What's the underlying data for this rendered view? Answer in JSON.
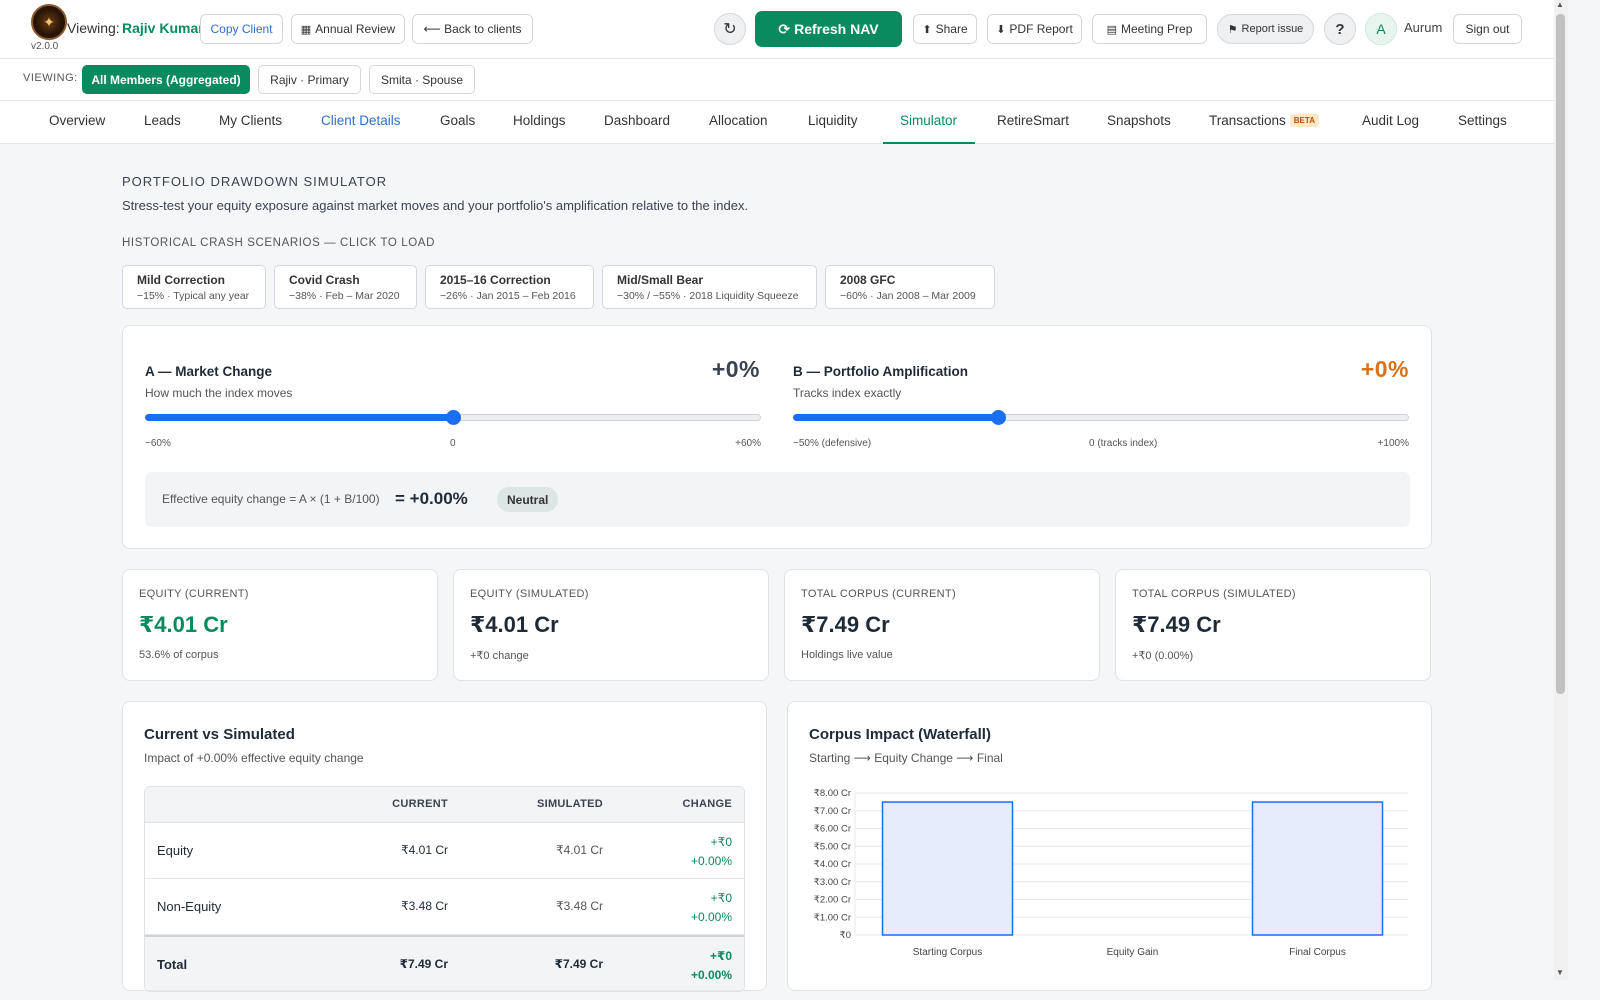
{
  "app": {
    "version": "v2.0.0",
    "viewing_label": "Viewing:",
    "client_name": "Rajiv Kumar",
    "user_initial": "A",
    "user_name": "Aurum"
  },
  "toolbar": {
    "copy_client": "Copy Client",
    "annual_review": "Annual Review",
    "back": "⟵ Back to clients",
    "refresh_nav": "Refresh NAV",
    "share": "Share",
    "pdf": "PDF Report",
    "meeting": "Meeting Prep",
    "report_issue": "Report issue",
    "help": "?",
    "sign_out": "Sign out"
  },
  "members": {
    "label": "VIEWING:",
    "items": [
      "All Members (Aggregated)",
      "Rajiv · Primary",
      "Smita · Spouse"
    ]
  },
  "tabs": [
    "Overview",
    "Leads",
    "My Clients",
    "Client Details",
    "Goals",
    "Holdings",
    "Dashboard",
    "Allocation",
    "Liquidity",
    "Simulator",
    "RetireSmart",
    "Snapshots",
    "Transactions",
    "Audit Log",
    "Settings"
  ],
  "tab_badge": "BETA",
  "simulator": {
    "title": "PORTFOLIO DRAWDOWN SIMULATOR",
    "description": "Stress-test your equity exposure against market moves and your portfolio's amplification relative to the index.",
    "scenarios_title": "HISTORICAL CRASH SCENARIOS — CLICK TO LOAD",
    "scenarios": [
      {
        "name": "Mild Correction",
        "detail": "−15% · Typical any year"
      },
      {
        "name": "Covid Crash",
        "detail": "−38% · Feb – Mar 2020"
      },
      {
        "name": "2015–16 Correction",
        "detail": "−26% · Jan 2015 – Feb 2016"
      },
      {
        "name": "Mid/Small Bear",
        "detail": "−30% / −55% · 2018 Liquidity Squeeze"
      },
      {
        "name": "2008 GFC",
        "detail": "−60% · Jan 2008 – Mar 2009"
      }
    ],
    "market": {
      "title": "A — Market Change",
      "subtitle": "How much the index moves",
      "value_label": "+0%",
      "value": 0,
      "min": -60,
      "max": 60,
      "ticks": [
        "−60%",
        "0",
        "+60%"
      ]
    },
    "amplification": {
      "title": "B — Portfolio Amplification",
      "subtitle": "Tracks index exactly",
      "value_label": "+0%",
      "value": 0,
      "min": -50,
      "max": 100,
      "ticks": [
        "−50% (defensive)",
        "0 (tracks index)",
        "+100%"
      ]
    },
    "effective": {
      "label": "Effective equity change = A × (1 + B/100)",
      "value": "= +0.00%",
      "badge": "Neutral"
    }
  },
  "stats": [
    {
      "label": "EQUITY (CURRENT)",
      "value": "₹4.01 Cr",
      "sub": "53.6% of corpus"
    },
    {
      "label": "EQUITY (SIMULATED)",
      "value": "₹4.01 Cr",
      "sub": "+₹0 change"
    },
    {
      "label": "TOTAL CORPUS (CURRENT)",
      "value": "₹7.49 Cr",
      "sub": "Holdings live value"
    },
    {
      "label": "TOTAL CORPUS (SIMULATED)",
      "value": "₹7.49 Cr",
      "sub": "+₹0 (0.00%)"
    }
  ],
  "comparison": {
    "title": "Current vs Simulated",
    "subtitle": "Impact of +0.00% effective equity change",
    "headers": [
      "",
      "CURRENT",
      "SIMULATED",
      "CHANGE"
    ],
    "rows": [
      {
        "name": "Equity",
        "current": "₹4.01 Cr",
        "simulated": "₹4.01 Cr",
        "change": "+₹0",
        "change_pct": "+0.00%"
      },
      {
        "name": "Non-Equity",
        "current": "₹3.48 Cr",
        "simulated": "₹3.48 Cr",
        "change": "+₹0",
        "change_pct": "+0.00%"
      },
      {
        "name": "Total",
        "current": "₹7.49 Cr",
        "simulated": "₹7.49 Cr",
        "change": "+₹0",
        "change_pct": "+0.00%"
      }
    ]
  },
  "waterfall": {
    "title": "Corpus Impact (Waterfall)",
    "subtitle": "Starting ⟶ Equity Change ⟶ Final"
  },
  "chart_data": {
    "type": "bar",
    "categories": [
      "Starting Corpus",
      "Equity Gain",
      "Final Corpus"
    ],
    "values": [
      7.49,
      0,
      7.49
    ],
    "ylim": [
      0,
      8
    ],
    "yticks": [
      "₹0",
      "₹1.00 Cr",
      "₹2.00 Cr",
      "₹3.00 Cr",
      "₹4.00 Cr",
      "₹5.00 Cr",
      "₹6.00 Cr",
      "₹7.00 Cr",
      "₹8.00 Cr"
    ],
    "grid": true,
    "colors": {
      "fill": "#e6ecfb",
      "stroke": "#1a6ff0"
    }
  },
  "colors": {
    "brand": "#0a8a5f",
    "accent_orange": "#d9731b",
    "slider": "#1a6ff0"
  }
}
